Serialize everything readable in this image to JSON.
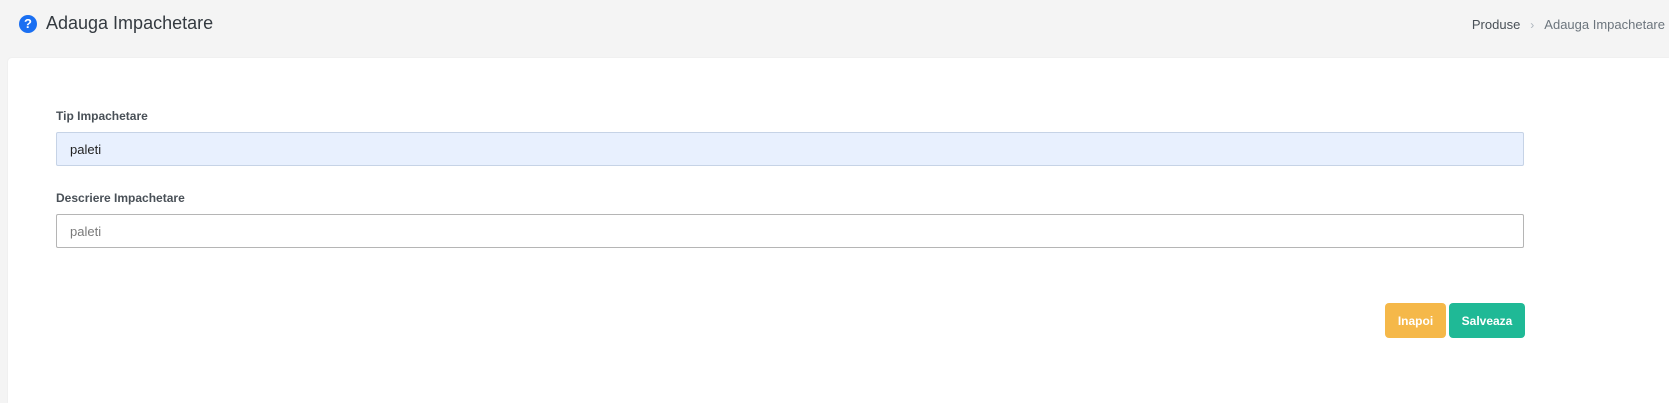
{
  "header": {
    "title": "Adauga Impachetare",
    "help_icon": "question-circle-icon",
    "help_glyph": "?",
    "icon_color": "#1a6ff2"
  },
  "breadcrumb": {
    "items": [
      {
        "label": "Produse"
      },
      {
        "label": "Adauga Impachetare"
      }
    ],
    "separator": "›"
  },
  "form": {
    "tip": {
      "label": "Tip Impachetare",
      "value": "paleti"
    },
    "descriere": {
      "label": "Descriere Impachetare",
      "placeholder": "paleti"
    }
  },
  "actions": {
    "back_label": "Inapoi",
    "back_color": "#f5b849",
    "save_label": "Salveaza",
    "save_color": "#1fb996"
  }
}
